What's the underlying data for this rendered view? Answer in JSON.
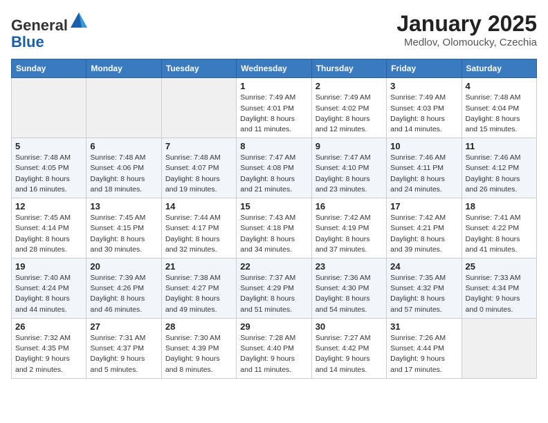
{
  "header": {
    "logo_general": "General",
    "logo_blue": "Blue",
    "title": "January 2025",
    "subtitle": "Medlov, Olomoucky, Czechia"
  },
  "weekdays": [
    "Sunday",
    "Monday",
    "Tuesday",
    "Wednesday",
    "Thursday",
    "Friday",
    "Saturday"
  ],
  "weeks": [
    [
      {
        "day": "",
        "info": ""
      },
      {
        "day": "",
        "info": ""
      },
      {
        "day": "",
        "info": ""
      },
      {
        "day": "1",
        "info": "Sunrise: 7:49 AM\nSunset: 4:01 PM\nDaylight: 8 hours\nand 11 minutes."
      },
      {
        "day": "2",
        "info": "Sunrise: 7:49 AM\nSunset: 4:02 PM\nDaylight: 8 hours\nand 12 minutes."
      },
      {
        "day": "3",
        "info": "Sunrise: 7:49 AM\nSunset: 4:03 PM\nDaylight: 8 hours\nand 14 minutes."
      },
      {
        "day": "4",
        "info": "Sunrise: 7:48 AM\nSunset: 4:04 PM\nDaylight: 8 hours\nand 15 minutes."
      }
    ],
    [
      {
        "day": "5",
        "info": "Sunrise: 7:48 AM\nSunset: 4:05 PM\nDaylight: 8 hours\nand 16 minutes."
      },
      {
        "day": "6",
        "info": "Sunrise: 7:48 AM\nSunset: 4:06 PM\nDaylight: 8 hours\nand 18 minutes."
      },
      {
        "day": "7",
        "info": "Sunrise: 7:48 AM\nSunset: 4:07 PM\nDaylight: 8 hours\nand 19 minutes."
      },
      {
        "day": "8",
        "info": "Sunrise: 7:47 AM\nSunset: 4:08 PM\nDaylight: 8 hours\nand 21 minutes."
      },
      {
        "day": "9",
        "info": "Sunrise: 7:47 AM\nSunset: 4:10 PM\nDaylight: 8 hours\nand 23 minutes."
      },
      {
        "day": "10",
        "info": "Sunrise: 7:46 AM\nSunset: 4:11 PM\nDaylight: 8 hours\nand 24 minutes."
      },
      {
        "day": "11",
        "info": "Sunrise: 7:46 AM\nSunset: 4:12 PM\nDaylight: 8 hours\nand 26 minutes."
      }
    ],
    [
      {
        "day": "12",
        "info": "Sunrise: 7:45 AM\nSunset: 4:14 PM\nDaylight: 8 hours\nand 28 minutes."
      },
      {
        "day": "13",
        "info": "Sunrise: 7:45 AM\nSunset: 4:15 PM\nDaylight: 8 hours\nand 30 minutes."
      },
      {
        "day": "14",
        "info": "Sunrise: 7:44 AM\nSunset: 4:17 PM\nDaylight: 8 hours\nand 32 minutes."
      },
      {
        "day": "15",
        "info": "Sunrise: 7:43 AM\nSunset: 4:18 PM\nDaylight: 8 hours\nand 34 minutes."
      },
      {
        "day": "16",
        "info": "Sunrise: 7:42 AM\nSunset: 4:19 PM\nDaylight: 8 hours\nand 37 minutes."
      },
      {
        "day": "17",
        "info": "Sunrise: 7:42 AM\nSunset: 4:21 PM\nDaylight: 8 hours\nand 39 minutes."
      },
      {
        "day": "18",
        "info": "Sunrise: 7:41 AM\nSunset: 4:22 PM\nDaylight: 8 hours\nand 41 minutes."
      }
    ],
    [
      {
        "day": "19",
        "info": "Sunrise: 7:40 AM\nSunset: 4:24 PM\nDaylight: 8 hours\nand 44 minutes."
      },
      {
        "day": "20",
        "info": "Sunrise: 7:39 AM\nSunset: 4:26 PM\nDaylight: 8 hours\nand 46 minutes."
      },
      {
        "day": "21",
        "info": "Sunrise: 7:38 AM\nSunset: 4:27 PM\nDaylight: 8 hours\nand 49 minutes."
      },
      {
        "day": "22",
        "info": "Sunrise: 7:37 AM\nSunset: 4:29 PM\nDaylight: 8 hours\nand 51 minutes."
      },
      {
        "day": "23",
        "info": "Sunrise: 7:36 AM\nSunset: 4:30 PM\nDaylight: 8 hours\nand 54 minutes."
      },
      {
        "day": "24",
        "info": "Sunrise: 7:35 AM\nSunset: 4:32 PM\nDaylight: 8 hours\nand 57 minutes."
      },
      {
        "day": "25",
        "info": "Sunrise: 7:33 AM\nSunset: 4:34 PM\nDaylight: 9 hours\nand 0 minutes."
      }
    ],
    [
      {
        "day": "26",
        "info": "Sunrise: 7:32 AM\nSunset: 4:35 PM\nDaylight: 9 hours\nand 2 minutes."
      },
      {
        "day": "27",
        "info": "Sunrise: 7:31 AM\nSunset: 4:37 PM\nDaylight: 9 hours\nand 5 minutes."
      },
      {
        "day": "28",
        "info": "Sunrise: 7:30 AM\nSunset: 4:39 PM\nDaylight: 9 hours\nand 8 minutes."
      },
      {
        "day": "29",
        "info": "Sunrise: 7:28 AM\nSunset: 4:40 PM\nDaylight: 9 hours\nand 11 minutes."
      },
      {
        "day": "30",
        "info": "Sunrise: 7:27 AM\nSunset: 4:42 PM\nDaylight: 9 hours\nand 14 minutes."
      },
      {
        "day": "31",
        "info": "Sunrise: 7:26 AM\nSunset: 4:44 PM\nDaylight: 9 hours\nand 17 minutes."
      },
      {
        "day": "",
        "info": ""
      }
    ]
  ]
}
